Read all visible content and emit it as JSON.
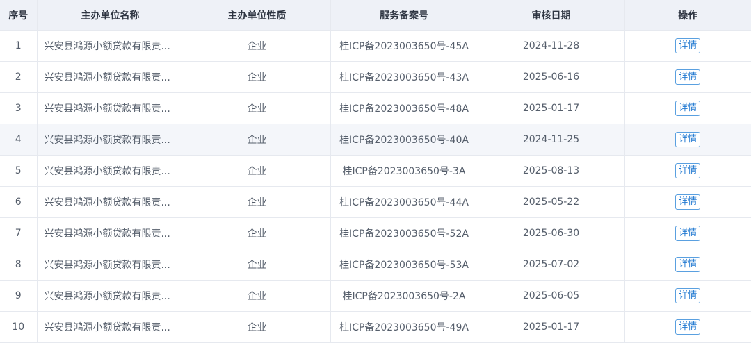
{
  "table": {
    "headers": [
      "序号",
      "主办单位名称",
      "主办单位性质",
      "服务备案号",
      "审核日期",
      "操作"
    ],
    "rows": [
      {
        "index": "1",
        "name": "兴安县鸿源小额贷款有限责...",
        "nature": "企业",
        "record": "桂ICP备2023003650号-45A",
        "date": "2024-11-28",
        "action": "详情"
      },
      {
        "index": "2",
        "name": "兴安县鸿源小额贷款有限责...",
        "nature": "企业",
        "record": "桂ICP备2023003650号-43A",
        "date": "2025-06-16",
        "action": "详情"
      },
      {
        "index": "3",
        "name": "兴安县鸿源小额贷款有限责...",
        "nature": "企业",
        "record": "桂ICP备2023003650号-48A",
        "date": "2025-01-17",
        "action": "详情"
      },
      {
        "index": "4",
        "name": "兴安县鸿源小额贷款有限责...",
        "nature": "企业",
        "record": "桂ICP备2023003650号-40A",
        "date": "2024-11-25",
        "action": "详情"
      },
      {
        "index": "5",
        "name": "兴安县鸿源小额贷款有限责...",
        "nature": "企业",
        "record": "桂ICP备2023003650号-3A",
        "date": "2025-08-13",
        "action": "详情"
      },
      {
        "index": "6",
        "name": "兴安县鸿源小额贷款有限责...",
        "nature": "企业",
        "record": "桂ICP备2023003650号-44A",
        "date": "2025-05-22",
        "action": "详情"
      },
      {
        "index": "7",
        "name": "兴安县鸿源小额贷款有限责...",
        "nature": "企业",
        "record": "桂ICP备2023003650号-52A",
        "date": "2025-06-30",
        "action": "详情"
      },
      {
        "index": "8",
        "name": "兴安县鸿源小额贷款有限责...",
        "nature": "企业",
        "record": "桂ICP备2023003650号-53A",
        "date": "2025-07-02",
        "action": "详情"
      },
      {
        "index": "9",
        "name": "兴安县鸿源小额贷款有限责...",
        "nature": "企业",
        "record": "桂ICP备2023003650号-2A",
        "date": "2025-06-05",
        "action": "详情"
      },
      {
        "index": "10",
        "name": "兴安县鸿源小额贷款有限责...",
        "nature": "企业",
        "record": "桂ICP备2023003650号-49A",
        "date": "2025-01-17",
        "action": "详情"
      }
    ]
  },
  "colors": {
    "header_bg": "#eef1f7",
    "highlight_row_bg": "#f4f6fa",
    "border": "#e6e9ef",
    "link_blue": "#1f78d1"
  }
}
